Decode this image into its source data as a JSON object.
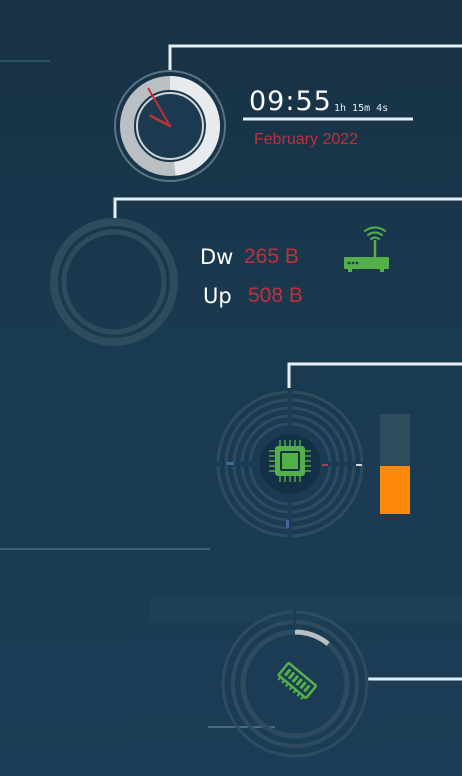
{
  "clock": {
    "time": "09:55",
    "uptime": "1h 15m 4s",
    "date": "February 2022",
    "hour_hand_angle_deg": 297.5,
    "minute_hand_angle_deg": 330
  },
  "network": {
    "down_label": "Dw",
    "down_value": "265 B",
    "up_label": "Up",
    "up_value": "508 B",
    "icon": "router-icon"
  },
  "cpu": {
    "icon": "cpu-chip-icon",
    "usage_fraction": 0.48
  },
  "memory": {
    "icon": "ram-module-icon",
    "usage_fraction": 0.11
  },
  "colors": {
    "accent_red": "#c0303a",
    "icon_green": "#55b04a",
    "bar_orange": "#ff8a0a",
    "line_white": "#e6eef3",
    "ring_dark": "#2f4c5e"
  }
}
